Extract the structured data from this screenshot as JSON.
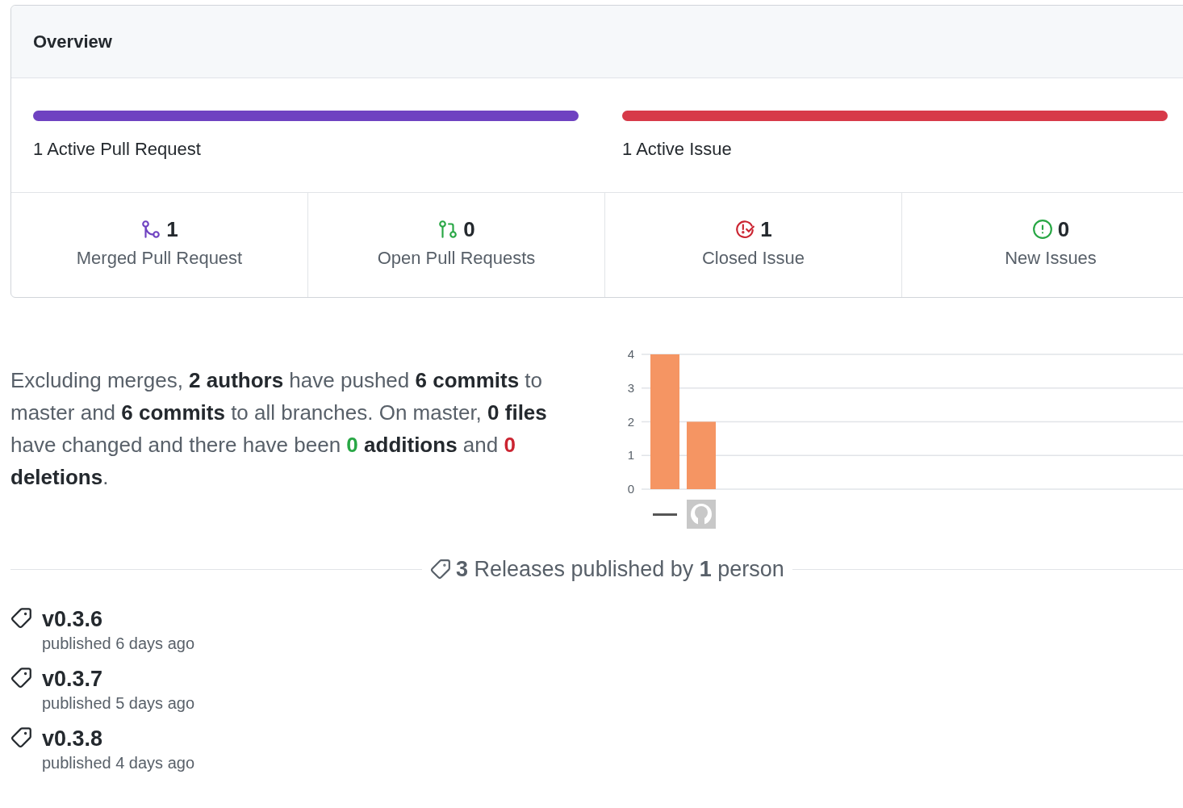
{
  "overview": {
    "title": "Overview",
    "bars": [
      {
        "kind": "pull_request",
        "label": "1 Active Pull Request",
        "level": 1
      },
      {
        "kind": "issue",
        "label": "1 Active Issue",
        "level": 1
      }
    ],
    "stats": [
      {
        "kind": "merged",
        "count": "1",
        "label": "Merged Pull Request"
      },
      {
        "kind": "open_pr",
        "count": "0",
        "label": "Open Pull Requests"
      },
      {
        "kind": "closed_issue",
        "count": "1",
        "label": "Closed Issue"
      },
      {
        "kind": "new_issue",
        "count": "0",
        "label": "New Issues"
      }
    ]
  },
  "summary": [
    {
      "kind": "plain",
      "text": "Excluding merges, "
    },
    {
      "kind": "bold",
      "text": "2 authors"
    },
    {
      "kind": "plain",
      "text": " have pushed "
    },
    {
      "kind": "bold",
      "text": "6 commits"
    },
    {
      "kind": "plain",
      "text": " to master and "
    },
    {
      "kind": "bold",
      "text": "6 commits"
    },
    {
      "kind": "plain",
      "text": " to all branches. On master, "
    },
    {
      "kind": "bold",
      "text": "0 files"
    },
    {
      "kind": "plain",
      "text": " have changed and there have been "
    },
    {
      "kind": "added",
      "text": "0"
    },
    {
      "kind": "bold",
      "text": " additions"
    },
    {
      "kind": "plain",
      "text": " and "
    },
    {
      "kind": "removed",
      "text": "0"
    },
    {
      "kind": "bold",
      "text": " deletions"
    },
    {
      "kind": "plain",
      "text": "."
    }
  ],
  "chart_data": {
    "type": "bar",
    "ylim": [
      0,
      4
    ],
    "yticks": [
      0,
      1,
      2,
      3,
      4
    ],
    "grid": true,
    "series": [
      {
        "color": "#f59563",
        "values": [
          4,
          2
        ]
      }
    ]
  },
  "releases": {
    "heading": "**3** Releases published by **1** person",
    "items": [
      {
        "version": "v0.3.6",
        "published": "published 6 days ago"
      },
      {
        "version": "v0.3.7",
        "published": "published 5 days ago"
      },
      {
        "version": "v0.3.8",
        "published": "published 4 days ago"
      }
    ]
  }
}
